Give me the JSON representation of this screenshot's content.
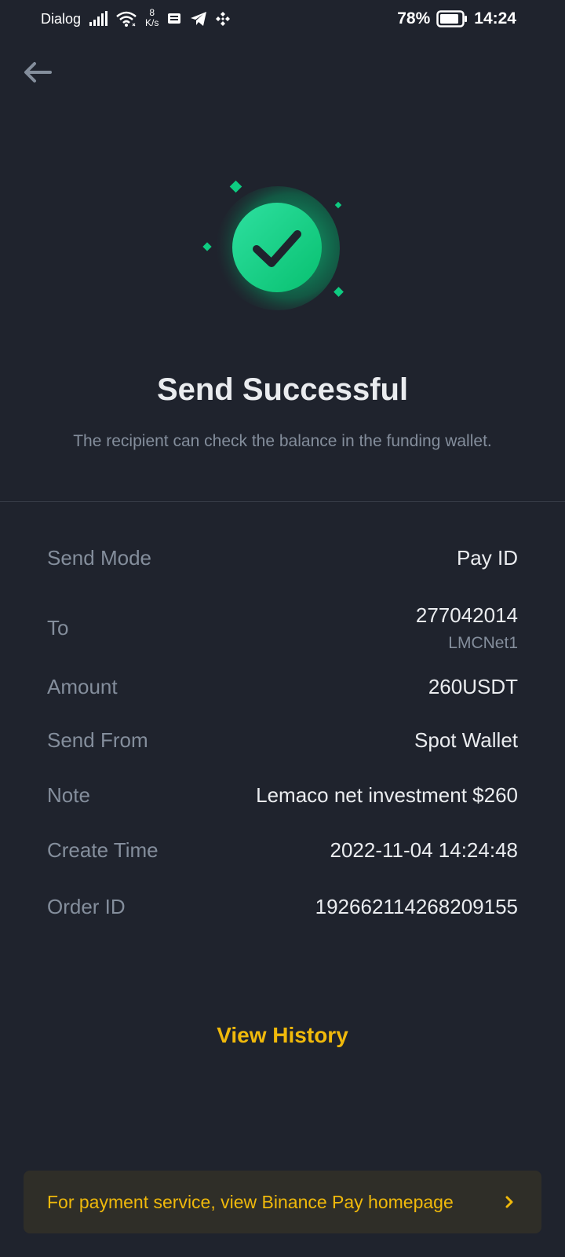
{
  "status_bar": {
    "carrier": "Dialog",
    "speed_value": "8",
    "speed_unit": "K/s",
    "battery": "78%",
    "time": "14:24",
    "icons": [
      "signal-icon",
      "wifi-icon",
      "message-icon",
      "telegram-icon",
      "binance-icon",
      "battery-icon"
    ]
  },
  "header": {
    "back_icon": "arrow-left-icon"
  },
  "result": {
    "title": "Send Successful",
    "subtitle": "The recipient can check the balance in the funding wallet."
  },
  "details": {
    "send_mode": {
      "label": "Send Mode",
      "value": "Pay ID"
    },
    "to": {
      "label": "To",
      "value": "277042014",
      "sub": "LMCNet1"
    },
    "amount": {
      "label": "Amount",
      "value": "260USDT"
    },
    "send_from": {
      "label": "Send From",
      "value": "Spot Wallet"
    },
    "note": {
      "label": "Note",
      "value": "Lemaco net investment $260"
    },
    "create_time": {
      "label": "Create Time",
      "value": "2022-11-04 14:24:48"
    },
    "order_id": {
      "label": "Order ID",
      "value": "192662114268209155"
    }
  },
  "actions": {
    "view_history": "View History",
    "pay_banner": "For payment service, view Binance Pay homepage"
  },
  "colors": {
    "background": "#1f232d",
    "accent": "#f0b90b",
    "success": "#0ecb81",
    "label": "#848e9c",
    "text": "#eaecef"
  }
}
